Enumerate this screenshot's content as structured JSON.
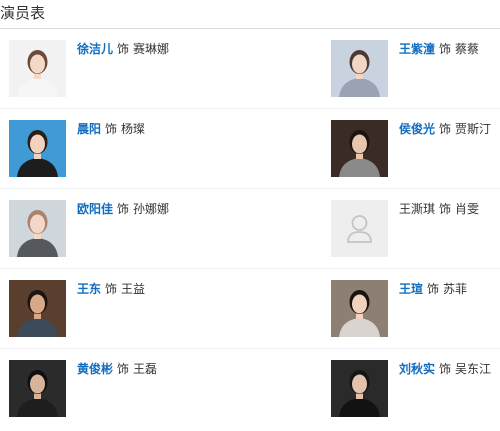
{
  "section": {
    "title": "演员表"
  },
  "cast": [
    {
      "left": {
        "actor": "徐洁儿",
        "linked": true,
        "as": "饰",
        "role": "赛琳娜",
        "photo": {
          "icon": "actor-portrait",
          "bg": "#f2f2f2",
          "hair": "#6b4a3a",
          "skin": "#f4d9c8",
          "cloth": "#f6f6f6"
        }
      },
      "right": {
        "actor": "王紫潼",
        "linked": true,
        "as": "饰",
        "role": "蔡蔡",
        "photo": {
          "icon": "actor-portrait",
          "bg": "#c9d3df",
          "hair": "#4a3a33",
          "skin": "#f1d6c6",
          "cloth": "#9aa3b3"
        }
      }
    },
    {
      "left": {
        "actor": "晨阳",
        "linked": true,
        "as": "饰",
        "role": "杨璨",
        "photo": {
          "icon": "actor-portrait",
          "bg": "#3f9ad6",
          "hair": "#2a1e18",
          "skin": "#f0d2bf",
          "cloth": "#1d1d1d"
        }
      },
      "right": {
        "actor": "侯俊光",
        "linked": true,
        "as": "饰",
        "role": "贾斯汀",
        "photo": {
          "icon": "actor-portrait",
          "bg": "#3a2c24",
          "hair": "#1a1512",
          "skin": "#e8c6ad",
          "cloth": "#8a8a8a"
        }
      }
    },
    {
      "left": {
        "actor": "欧阳佳",
        "linked": true,
        "as": "饰",
        "role": "孙娜娜",
        "photo": {
          "icon": "actor-portrait",
          "bg": "#cfd6dc",
          "hair": "#a9826c",
          "skin": "#f3d8c8",
          "cloth": "#55585c"
        }
      },
      "right": {
        "actor": "王澌琪",
        "linked": false,
        "as": "饰",
        "role": "肖雯",
        "photo": {
          "icon": "user-placeholder-icon",
          "bg": "#eeeeee"
        }
      }
    },
    {
      "left": {
        "actor": "王东",
        "linked": true,
        "as": "饰",
        "role": "王益",
        "photo": {
          "icon": "actor-portrait",
          "bg": "#5a3e2e",
          "hair": "#1b1410",
          "skin": "#d9a888",
          "cloth": "#3c4a5a"
        }
      },
      "right": {
        "actor": "王瑄",
        "linked": true,
        "as": "饰",
        "role": "苏菲",
        "photo": {
          "icon": "actor-portrait",
          "bg": "#8d8073",
          "hair": "#1a1410",
          "skin": "#f0d2bf",
          "cloth": "#d9d4cf"
        }
      }
    },
    {
      "left": {
        "actor": "黄俊彬",
        "linked": true,
        "as": "饰",
        "role": "王磊",
        "photo": {
          "icon": "actor-portrait",
          "bg": "#2b2b2b",
          "hair": "#0f0f0f",
          "skin": "#d7b39a",
          "cloth": "#1e1e1e"
        }
      },
      "right": {
        "actor": "刘秋实",
        "linked": true,
        "as": "饰",
        "role": "吴东江",
        "photo": {
          "icon": "actor-portrait",
          "bg": "#2a2a2a",
          "hair": "#161616",
          "skin": "#e2c2ab",
          "cloth": "#121212"
        }
      }
    }
  ]
}
